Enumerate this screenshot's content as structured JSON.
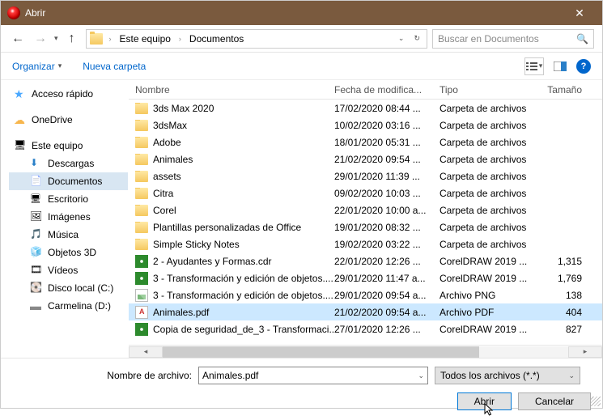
{
  "window": {
    "title": "Abrir"
  },
  "path": {
    "root": "Este equipo",
    "folder": "Documentos"
  },
  "search": {
    "placeholder": "Buscar en Documentos"
  },
  "toolbar": {
    "organize": "Organizar",
    "newfolder": "Nueva carpeta"
  },
  "sidebar": {
    "quick": "Acceso rápido",
    "onedrive": "OneDrive",
    "thispc": "Este equipo",
    "downloads": "Descargas",
    "documents": "Documentos",
    "desktop": "Escritorio",
    "pictures": "Imágenes",
    "music": "Música",
    "objects3d": "Objetos 3D",
    "videos": "Vídeos",
    "diskc": "Disco local (C:)",
    "diskd": "Carmelina (D:)"
  },
  "columns": {
    "name": "Nombre",
    "date": "Fecha de modifica...",
    "type": "Tipo",
    "size": "Tamaño"
  },
  "files": [
    {
      "icon": "folder",
      "name": "3ds Max 2020",
      "date": "17/02/2020 08:44 ...",
      "type": "Carpeta de archivos",
      "size": ""
    },
    {
      "icon": "folder",
      "name": "3dsMax",
      "date": "10/02/2020 03:16 ...",
      "type": "Carpeta de archivos",
      "size": ""
    },
    {
      "icon": "folder",
      "name": "Adobe",
      "date": "18/01/2020 05:31 ...",
      "type": "Carpeta de archivos",
      "size": ""
    },
    {
      "icon": "folder",
      "name": "Animales",
      "date": "21/02/2020 09:54 ...",
      "type": "Carpeta de archivos",
      "size": ""
    },
    {
      "icon": "folder",
      "name": "assets",
      "date": "29/01/2020 11:39 ...",
      "type": "Carpeta de archivos",
      "size": ""
    },
    {
      "icon": "folder",
      "name": "Citra",
      "date": "09/02/2020 10:03 ...",
      "type": "Carpeta de archivos",
      "size": ""
    },
    {
      "icon": "folder",
      "name": "Corel",
      "date": "22/01/2020 10:00 a...",
      "type": "Carpeta de archivos",
      "size": ""
    },
    {
      "icon": "folder",
      "name": "Plantillas personalizadas de Office",
      "date": "19/01/2020 08:32 ...",
      "type": "Carpeta de archivos",
      "size": ""
    },
    {
      "icon": "folder",
      "name": "Simple Sticky Notes",
      "date": "19/02/2020 03:22 ...",
      "type": "Carpeta de archivos",
      "size": ""
    },
    {
      "icon": "cdr",
      "name": "2 - Ayudantes y Formas.cdr",
      "date": "22/01/2020 12:26 ...",
      "type": "CorelDRAW 2019 ...",
      "size": "1,315"
    },
    {
      "icon": "cdr",
      "name": "3 - Transformación y edición de objetos....",
      "date": "29/01/2020 11:47 a...",
      "type": "CorelDRAW 2019 ...",
      "size": "1,769"
    },
    {
      "icon": "png",
      "name": "3 - Transformación y edición de objetos....",
      "date": "29/01/2020 09:54 a...",
      "type": "Archivo PNG",
      "size": "138"
    },
    {
      "icon": "pdf",
      "name": "Animales.pdf",
      "date": "21/02/2020 09:54 a...",
      "type": "Archivo PDF",
      "size": "404",
      "selected": true
    },
    {
      "icon": "cdr",
      "name": "Copia de seguridad_de_3 - Transformaci...",
      "date": "27/01/2020 12:26 ...",
      "type": "CorelDRAW 2019 ...",
      "size": "827"
    }
  ],
  "footer": {
    "label": "Nombre de archivo:",
    "filename": "Animales.pdf",
    "filter": "Todos los archivos (*.*)",
    "open": "Abrir",
    "cancel": "Cancelar"
  }
}
